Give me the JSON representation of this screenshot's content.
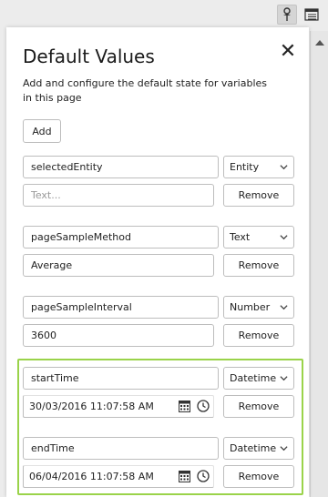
{
  "toolbar": {
    "pin_icon": "pin-icon",
    "panel_icon": "panel-icon"
  },
  "panel": {
    "title": "Default Values",
    "close_symbol": "✕",
    "description": "Add and configure the default state for variables in this page",
    "add_label": "Add",
    "remove_label": "Remove"
  },
  "variables": [
    {
      "name": "selectedEntity",
      "type": "Entity",
      "value": "",
      "placeholder": "Text..."
    },
    {
      "name": "pageSampleMethod",
      "type": "Text",
      "value": "Average",
      "placeholder": ""
    },
    {
      "name": "pageSampleInterval",
      "type": "Number",
      "value": "3600",
      "placeholder": ""
    },
    {
      "name": "startTime",
      "type": "Datetime",
      "value": "30/03/2016 11:07:58 AM",
      "placeholder": ""
    },
    {
      "name": "endTime",
      "type": "Datetime",
      "value": "06/04/2016 11:07:58 AM",
      "placeholder": ""
    }
  ],
  "colors": {
    "highlight": "#9ad34a",
    "border": "#bdbdbd"
  }
}
